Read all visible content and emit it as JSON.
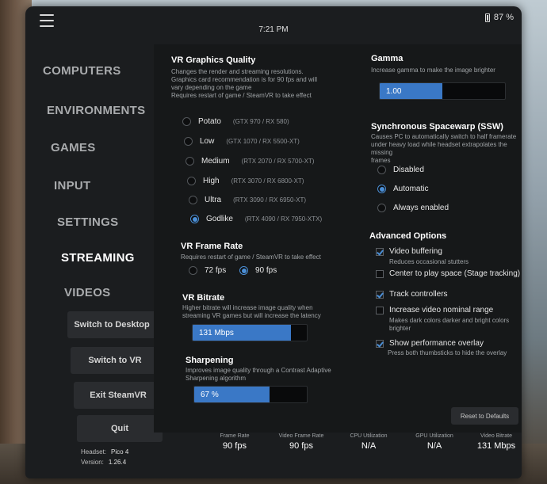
{
  "topbar": {
    "time": "7:21 PM",
    "battery": "87 %"
  },
  "sidebar": {
    "nav": [
      "COMPUTERS",
      "ENVIRONMENTS",
      "GAMES",
      "INPUT",
      "SETTINGS",
      "STREAMING",
      "VIDEOS"
    ],
    "active": "STREAMING",
    "buttons": [
      "Switch to Desktop",
      "Switch to VR",
      "Exit SteamVR",
      "Quit"
    ],
    "headset_label": "Headset:",
    "headset_value": "Pico 4",
    "version_label": "Version:",
    "version_value": "1.26.4"
  },
  "graphics": {
    "title": "VR Graphics Quality",
    "desc": [
      "Changes the render and streaming resolutions.",
      "Graphics card recommendation is for 90 fps and will",
      "vary depending on the game",
      "Requires restart of game / SteamVR to take effect"
    ],
    "options": [
      {
        "label": "Potato",
        "spec": "(GTX 970 / RX 580)",
        "selected": false
      },
      {
        "label": "Low",
        "spec": "(GTX 1070 / RX 5500-XT)",
        "selected": false
      },
      {
        "label": "Medium",
        "spec": "(RTX 2070 / RX 5700-XT)",
        "selected": false
      },
      {
        "label": "High",
        "spec": "(RTX 3070 / RX 6800-XT)",
        "selected": false
      },
      {
        "label": "Ultra",
        "spec": "(RTX 3090 / RX 6950-XT)",
        "selected": false
      },
      {
        "label": "Godlike",
        "spec": "(RTX 4090 / RX 7950-XTX)",
        "selected": true
      }
    ]
  },
  "framerate": {
    "title": "VR Frame Rate",
    "desc": "Requires restart of game / SteamVR to take effect",
    "options": [
      {
        "label": "72 fps",
        "selected": false
      },
      {
        "label": "90 fps",
        "selected": true
      }
    ]
  },
  "bitrate": {
    "title": "VR Bitrate",
    "desc": [
      "Higher bitrate will increase image quality when",
      "streaming VR games but will increase the latency"
    ],
    "value": "131 Mbps",
    "fill_fraction": 0.86
  },
  "sharpening": {
    "title": "Sharpening",
    "desc": [
      "Improves image quality through a Contrast Adaptive",
      "Sharpening algorithm"
    ],
    "value": "67 %",
    "fill_fraction": 0.67
  },
  "gamma": {
    "title": "Gamma",
    "desc": "Increase gamma to make the image brighter",
    "value": "1.00",
    "fill_fraction": 0.5
  },
  "ssw": {
    "title": "Synchronous Spacewarp (SSW)",
    "desc": [
      "Causes PC to automatically switch to half framerate",
      "under heavy load while headset extrapolates the missing",
      "frames"
    ],
    "options": [
      {
        "label": "Disabled",
        "selected": false
      },
      {
        "label": "Automatic",
        "selected": true
      },
      {
        "label": "Always enabled",
        "selected": false
      }
    ]
  },
  "advanced": {
    "title": "Advanced Options",
    "items": [
      {
        "label": "Video buffering",
        "checked": true,
        "sub": [
          "Reduces occasional stutters"
        ]
      },
      {
        "label": "Center to play space (Stage tracking)",
        "checked": false,
        "sub": []
      },
      {
        "label": "Track controllers",
        "checked": true,
        "sub": []
      },
      {
        "label": "Increase video nominal range",
        "checked": false,
        "sub": [
          "Makes dark colors darker and bright colors",
          "brighter"
        ]
      },
      {
        "label": "Show performance overlay",
        "checked": true,
        "sub": [
          "Press both thumbsticks to hide the overlay"
        ]
      }
    ],
    "reset_label": "Reset to Defaults"
  },
  "stats": [
    {
      "label": "Frame Rate",
      "value": "90 fps"
    },
    {
      "label": "Video Frame Rate",
      "value": "90 fps"
    },
    {
      "label": "CPU Utilization",
      "value": "N/A"
    },
    {
      "label": "GPU Utilization",
      "value": "N/A"
    },
    {
      "label": "Video Bitrate",
      "value": "131 Mbps"
    }
  ],
  "colors": {
    "accent": "#3a78c6",
    "panel": "#1b1d1f",
    "text": "#e8e8e8"
  }
}
